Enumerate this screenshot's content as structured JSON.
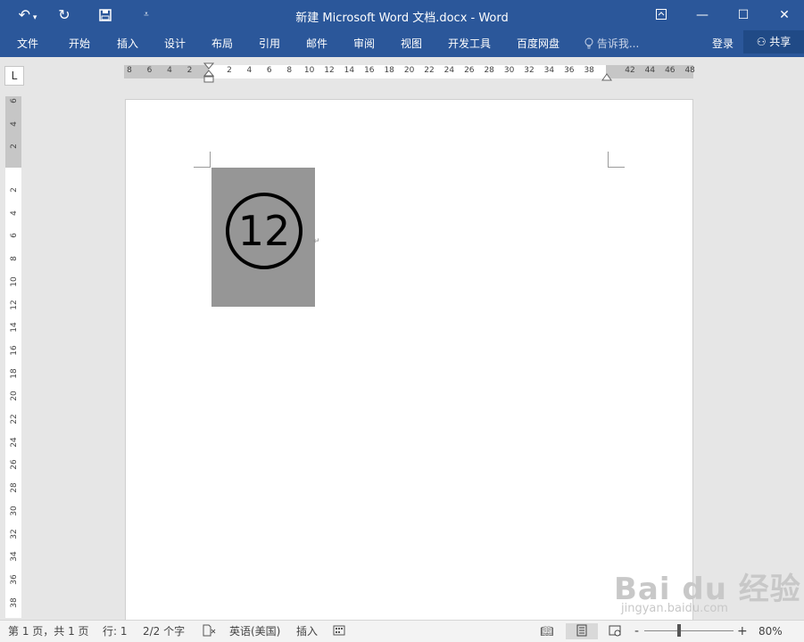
{
  "titlebar": {
    "title": "新建 Microsoft Word 文档.docx - Word",
    "undo_icon": "undo-icon",
    "redo_icon": "redo-icon",
    "save_icon": "save-icon",
    "customize_icon": "customize-quick-access-icon"
  },
  "window_controls": {
    "ribbon_display": "ribbon-display-options-icon",
    "minimize": "minimize-icon",
    "maximize": "maximize-icon",
    "close": "close-icon"
  },
  "ribbon": {
    "tabs": [
      "文件",
      "开始",
      "插入",
      "设计",
      "布局",
      "引用",
      "邮件",
      "审阅",
      "视图",
      "开发工具",
      "百度网盘"
    ],
    "tell_me": "告诉我...",
    "login": "登录",
    "share": "共享"
  },
  "ruler": {
    "corner": "L",
    "h_left_ticks": [
      "8",
      "6",
      "4",
      "2"
    ],
    "h_ticks": [
      "2",
      "4",
      "6",
      "8",
      "10",
      "12",
      "14",
      "16",
      "18",
      "20",
      "22",
      "24",
      "26",
      "28",
      "30",
      "32",
      "34",
      "36",
      "38"
    ],
    "h_right_ticks": [
      "42",
      "44",
      "46",
      "48"
    ],
    "v_top_ticks": [
      "6",
      "4",
      "2"
    ],
    "v_ticks": [
      "2",
      "4",
      "6",
      "8",
      "10",
      "12",
      "14",
      "16",
      "18",
      "20",
      "22",
      "24",
      "26",
      "28",
      "30",
      "32",
      "34",
      "36",
      "38"
    ]
  },
  "document": {
    "circled_number": "12",
    "paragraph_mark": "↵"
  },
  "statusbar": {
    "page": "第 1 页，共 1 页",
    "line": "行: 1",
    "words": "2/2 个字",
    "language": "英语(美国)",
    "mode": "插入",
    "zoom": "80%",
    "zoom_minus": "-",
    "zoom_plus": "+"
  },
  "watermark": {
    "brand": "Bai du 经验",
    "url": "jingyan.baidu.com"
  },
  "colors": {
    "accent": "#2b579a",
    "picture": "#969696"
  }
}
